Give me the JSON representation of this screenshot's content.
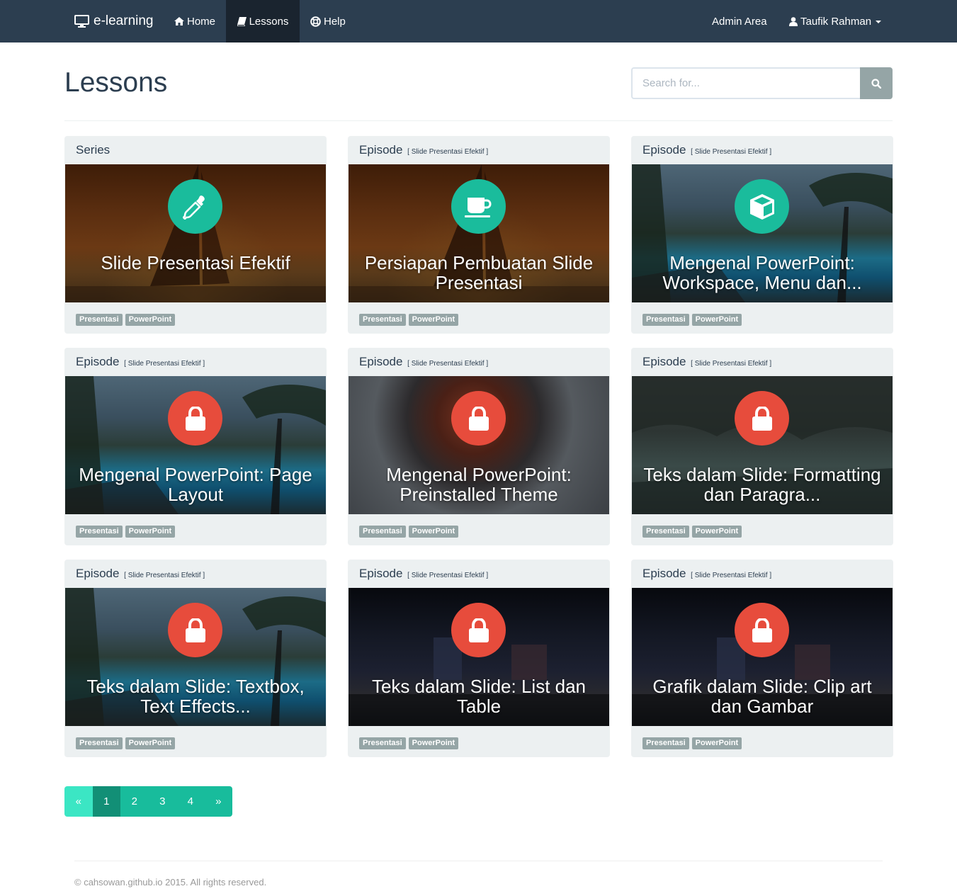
{
  "nav": {
    "brand": "e-learning",
    "home": "Home",
    "lessons": "Lessons",
    "help": "Help",
    "admin": "Admin Area",
    "user": "Taufik Rahman"
  },
  "header": {
    "title": "Lessons",
    "search_placeholder": "Search for..."
  },
  "cards": [
    {
      "kind": "Series",
      "ref": "",
      "title": "Slide Presentasi Efektif",
      "icon": "eyedropper-icon",
      "locked": false,
      "tags": [
        "Presentasi",
        "PowerPoint"
      ]
    },
    {
      "kind": "Episode",
      "ref": "[ Slide Presentasi Efektif ]",
      "title": "Persiapan Pembuatan Slide Presentasi",
      "icon": "coffee-cup-icon",
      "locked": false,
      "tags": [
        "Presentasi",
        "PowerPoint"
      ]
    },
    {
      "kind": "Episode",
      "ref": "[ Slide Presentasi Efektif ]",
      "title": "Mengenal PowerPoint: Workspace, Menu dan...",
      "icon": "cube-icon",
      "locked": false,
      "tags": [
        "Presentasi",
        "PowerPoint"
      ]
    },
    {
      "kind": "Episode",
      "ref": "[ Slide Presentasi Efektif ]",
      "title": "Mengenal PowerPoint: Page Layout",
      "icon": "lock-icon",
      "locked": true,
      "tags": [
        "Presentasi",
        "PowerPoint"
      ]
    },
    {
      "kind": "Episode",
      "ref": "[ Slide Presentasi Efektif ]",
      "title": "Mengenal PowerPoint: Preinstalled Theme",
      "icon": "lock-icon",
      "locked": true,
      "tags": [
        "Presentasi",
        "PowerPoint"
      ]
    },
    {
      "kind": "Episode",
      "ref": "[ Slide Presentasi Efektif ]",
      "title": "Teks dalam Slide: Formatting dan Paragra...",
      "icon": "lock-icon",
      "locked": true,
      "tags": [
        "Presentasi",
        "PowerPoint"
      ]
    },
    {
      "kind": "Episode",
      "ref": "[ Slide Presentasi Efektif ]",
      "title": "Teks dalam Slide: Textbox, Text Effects...",
      "icon": "lock-icon",
      "locked": true,
      "tags": [
        "Presentasi",
        "PowerPoint"
      ]
    },
    {
      "kind": "Episode",
      "ref": "[ Slide Presentasi Efektif ]",
      "title": "Teks dalam Slide: List dan Table",
      "icon": "lock-icon",
      "locked": true,
      "tags": [
        "Presentasi",
        "PowerPoint"
      ]
    },
    {
      "kind": "Episode",
      "ref": "[ Slide Presentasi Efektif ]",
      "title": "Grafik dalam Slide: Clip art dan Gambar",
      "icon": "lock-icon",
      "locked": true,
      "tags": [
        "Presentasi",
        "PowerPoint"
      ]
    }
  ],
  "pagination": {
    "prev": "«",
    "pages": [
      "1",
      "2",
      "3",
      "4"
    ],
    "current": "1",
    "next": "»"
  },
  "footer": {
    "text": "© cahsowan.github.io 2015. All rights reserved."
  },
  "colors": {
    "navbar": "#2c3e50",
    "accent": "#18bc9c",
    "danger": "#e74c3c",
    "tag": "#95a5a6",
    "card_bg": "#ecf0f1"
  }
}
